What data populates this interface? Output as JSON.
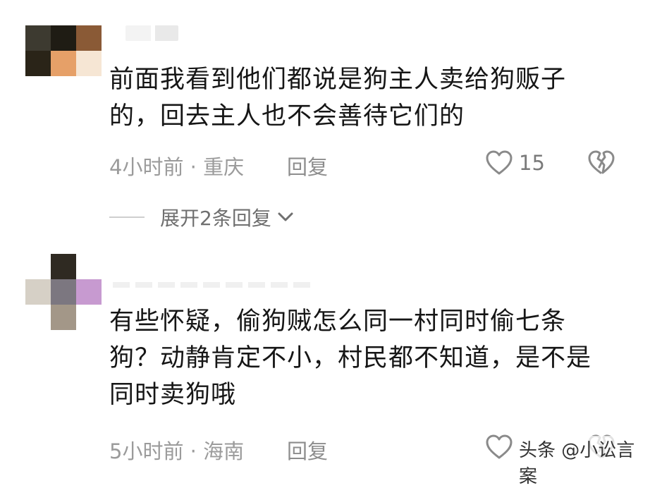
{
  "comments": [
    {
      "text": "前面我看到他们都说是狗主人卖给狗贩子的，回去主人也不会善待它们的",
      "meta": "4小时前 · 重庆",
      "reply_label": "回复",
      "likes": "15",
      "expand_replies": "展开2条回复"
    },
    {
      "text": "有些怀疑，偷狗贼怎么同一村同时偷七条狗？动静肯定不小，村民都不知道，是不是同时卖狗哦",
      "meta": "5小时前 · 海南",
      "reply_label": "回复"
    }
  ],
  "watermark": "头条 @小讼言案",
  "colors": {
    "text": "#161616",
    "meta": "#9b9b9b",
    "icon": "#8a8a8a"
  },
  "icons": {
    "like": "heart-outline-icon",
    "dislike": "broken-heart-icon",
    "expand": "chevron-down-icon"
  }
}
